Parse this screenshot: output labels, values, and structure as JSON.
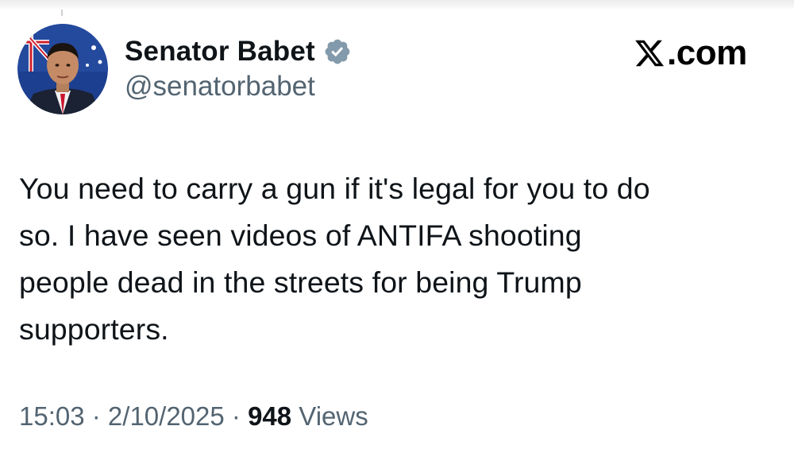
{
  "brand": {
    "logo_icon": "x-logo-icon",
    "suffix": ".com"
  },
  "author": {
    "avatar_icon": "profile-photo",
    "display_name": "Senator Babet",
    "verified_icon": "verified-badge-icon",
    "verified_color": "#829aab",
    "handle": "@senatorbabet"
  },
  "tweet": {
    "text": "You need to carry a gun if it's legal for you to do\nso. I have seen videos of ANTIFA shooting\npeople dead in the streets for being Trump\nsupporters."
  },
  "meta": {
    "time": "15:03",
    "separator": " · ",
    "date": "2/10/2025",
    "views_count": "948",
    "views_label": " Views"
  },
  "colors": {
    "text_primary": "#0f1419",
    "text_secondary": "#536471",
    "background": "#ffffff"
  }
}
